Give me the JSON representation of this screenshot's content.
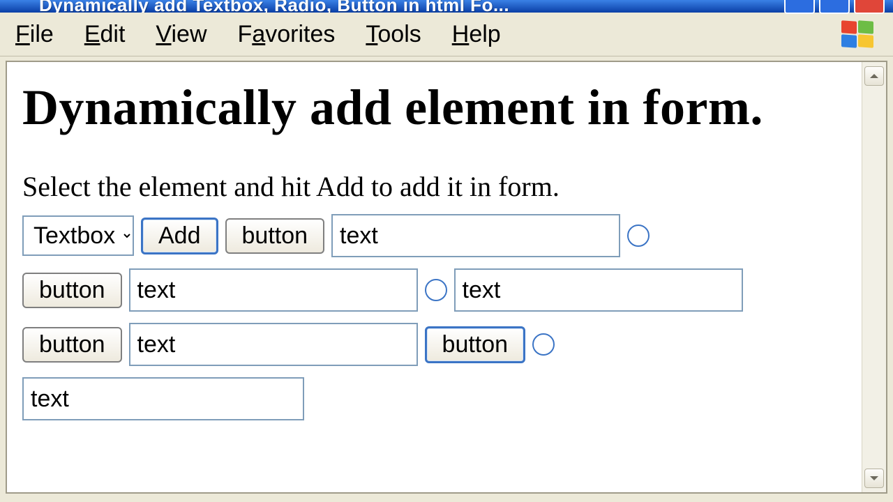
{
  "window": {
    "title": "Dynamically add Textbox, Radio, Button in html Fo..."
  },
  "menu": {
    "file": {
      "letter": "F",
      "rest": "ile"
    },
    "edit": {
      "letter": "E",
      "rest": "dit"
    },
    "view": {
      "letter": "V",
      "rest": "iew"
    },
    "favorites": {
      "letter": "a",
      "pre": "F",
      "rest": "vorites"
    },
    "tools": {
      "letter": "T",
      "rest": "ools"
    },
    "help": {
      "letter": "H",
      "rest": "elp"
    }
  },
  "page": {
    "heading": "Dynamically add element in form.",
    "instruction": "Select the element and hit Add to add it in form."
  },
  "controls": {
    "select_value": "Textbox",
    "add_label": "Add"
  },
  "dyn": {
    "btn": "button",
    "txt": "text"
  }
}
